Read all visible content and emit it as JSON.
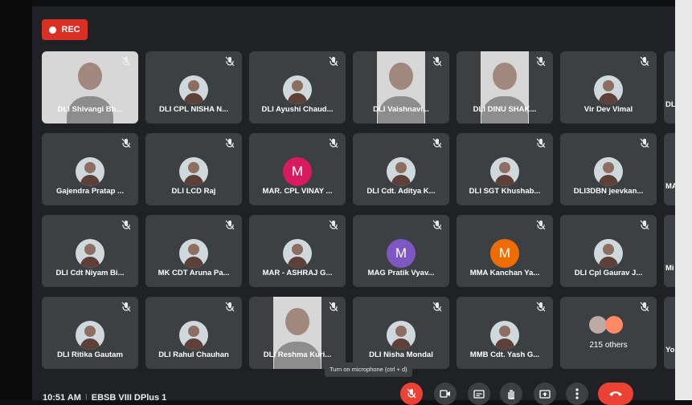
{
  "recording": {
    "label": "REC",
    "color": "#d93025"
  },
  "participants": [
    {
      "name": "DLI Shivangi Bh...",
      "kind": "video"
    },
    {
      "name": "DLI CPL NISHA N...",
      "kind": "photo"
    },
    {
      "name": "DLI Ayushi Chaud...",
      "kind": "photo"
    },
    {
      "name": "DLI Vaishnavi...",
      "kind": "video"
    },
    {
      "name": "DLI DINU SHAK...",
      "kind": "video"
    },
    {
      "name": "Vir Dev Vimal",
      "kind": "photo"
    },
    {
      "name": "DL",
      "kind": "partial"
    },
    {
      "name": "Gajendra Pratap ...",
      "kind": "photo"
    },
    {
      "name": "DLI LCD Raj",
      "kind": "photo"
    },
    {
      "name": "MAR. CPL VINAY ...",
      "kind": "initial",
      "initial": "M",
      "color": "#d81b60"
    },
    {
      "name": "DLI Cdt. Aditya K...",
      "kind": "photo"
    },
    {
      "name": "DLI SGT Khushab...",
      "kind": "photo"
    },
    {
      "name": "DLI3DBN jeevkan...",
      "kind": "photo"
    },
    {
      "name": "MA",
      "kind": "partial"
    },
    {
      "name": "DLI Cdt Niyam Bi...",
      "kind": "photo"
    },
    {
      "name": "MK CDT Aruna Pa...",
      "kind": "photo"
    },
    {
      "name": "MAR - ASHRAJ G...",
      "kind": "photo"
    },
    {
      "name": "MAG Pratik Vyav...",
      "kind": "initial",
      "initial": "M",
      "color": "#7e57c2"
    },
    {
      "name": "MMA Kanchan Ya...",
      "kind": "initial",
      "initial": "M",
      "color": "#ef6c00"
    },
    {
      "name": "DLI Cpl Gaurav J...",
      "kind": "photo"
    },
    {
      "name": "Mi",
      "kind": "partial"
    },
    {
      "name": "DLI Ritika Gautam",
      "kind": "photo"
    },
    {
      "name": "DLI Rahul Chauhan",
      "kind": "photo"
    },
    {
      "name": "DLI Reshma Kuri...",
      "kind": "video"
    },
    {
      "name": "DLI Nisha Mondal",
      "kind": "photo"
    },
    {
      "name": "MMB Cdt. Yash G...",
      "kind": "photo"
    },
    {
      "name": "215 others",
      "kind": "others"
    },
    {
      "name": "Yo",
      "kind": "partial"
    }
  ],
  "tooltip": "Turn on microphone (ctrl + d)",
  "footer": {
    "time": "10:51 AM",
    "separator": "|",
    "meeting": "EBSB VIII DPlus 1"
  },
  "icons": [
    "record-dot-icon",
    "mic-off-icon",
    "camera-icon",
    "captions-icon",
    "raise-hand-icon",
    "present-icon",
    "more-options-icon",
    "end-call-icon"
  ]
}
